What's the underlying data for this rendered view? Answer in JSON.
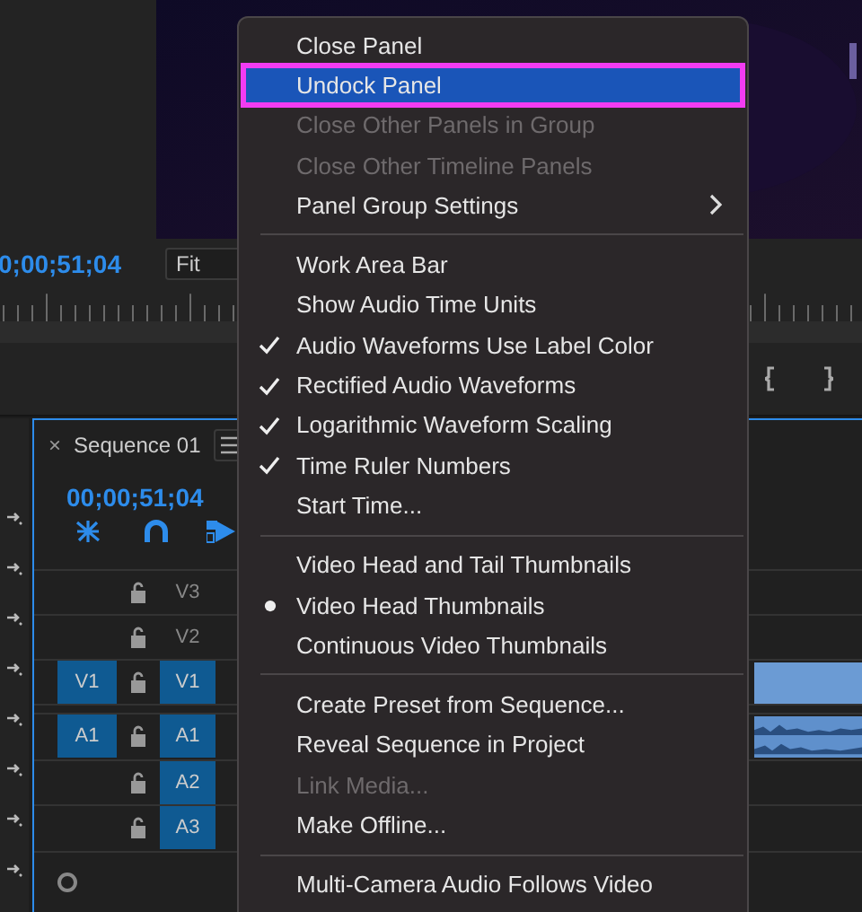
{
  "monitor": {
    "timecode": "0;00;51;04",
    "zoom": "Fit"
  },
  "sequence": {
    "close": "×",
    "tab": "Sequence 01",
    "timecode": "00;00;51;04",
    "tracks": [
      {
        "kind": "video",
        "label": "V3",
        "targeted": false,
        "clip": false
      },
      {
        "kind": "video",
        "label": "V2",
        "targeted": false,
        "clip": false
      },
      {
        "kind": "video",
        "source": "V1",
        "label": "V1",
        "targeted": true,
        "clip": true
      },
      {
        "kind": "audio",
        "source": "A1",
        "label": "A1",
        "targeted": true,
        "clip": true
      },
      {
        "kind": "audio",
        "label": "A2",
        "targeted": true,
        "clip": false
      },
      {
        "kind": "audio",
        "label": "A3",
        "targeted": true,
        "clip": false
      }
    ]
  },
  "menu": {
    "items": [
      {
        "kind": "item",
        "label": "Close Panel",
        "checked": false,
        "disabled": false,
        "selected": false,
        "submenu": false
      },
      {
        "kind": "item",
        "label": "Undock Panel",
        "checked": false,
        "disabled": false,
        "selected": true,
        "submenu": false
      },
      {
        "kind": "item",
        "label": "Close Other Panels in Group",
        "checked": false,
        "disabled": true,
        "selected": false,
        "submenu": false
      },
      {
        "kind": "item",
        "label": "Close Other Timeline Panels",
        "checked": false,
        "disabled": true,
        "selected": false,
        "submenu": false
      },
      {
        "kind": "item",
        "label": "Panel Group Settings",
        "checked": false,
        "disabled": false,
        "selected": false,
        "submenu": true
      },
      {
        "kind": "separator"
      },
      {
        "kind": "item",
        "label": "Work Area Bar",
        "checked": false,
        "disabled": false,
        "selected": false,
        "submenu": false
      },
      {
        "kind": "item",
        "label": "Show Audio Time Units",
        "checked": false,
        "disabled": false,
        "selected": false,
        "submenu": false
      },
      {
        "kind": "item",
        "label": "Audio Waveforms Use Label Color",
        "checked": true,
        "disabled": false,
        "selected": false,
        "submenu": false
      },
      {
        "kind": "item",
        "label": "Rectified Audio Waveforms",
        "checked": true,
        "disabled": false,
        "selected": false,
        "submenu": false
      },
      {
        "kind": "item",
        "label": "Logarithmic Waveform Scaling",
        "checked": true,
        "disabled": false,
        "selected": false,
        "submenu": false
      },
      {
        "kind": "item",
        "label": "Time Ruler Numbers",
        "checked": true,
        "disabled": false,
        "selected": false,
        "submenu": false
      },
      {
        "kind": "item",
        "label": "Start Time...",
        "checked": false,
        "disabled": false,
        "selected": false,
        "submenu": false
      },
      {
        "kind": "separator"
      },
      {
        "kind": "radio",
        "label": "Video Head and Tail Thumbnails",
        "checked": false,
        "disabled": false,
        "selected": false,
        "submenu": false
      },
      {
        "kind": "radio",
        "label": "Video Head Thumbnails",
        "checked": true,
        "disabled": false,
        "selected": false,
        "submenu": false
      },
      {
        "kind": "radio",
        "label": "Continuous Video Thumbnails",
        "checked": false,
        "disabled": false,
        "selected": false,
        "submenu": false
      },
      {
        "kind": "separator"
      },
      {
        "kind": "item",
        "label": "Create Preset from Sequence...",
        "checked": false,
        "disabled": false,
        "selected": false,
        "submenu": false
      },
      {
        "kind": "item",
        "label": "Reveal Sequence in Project",
        "checked": false,
        "disabled": false,
        "selected": false,
        "submenu": false
      },
      {
        "kind": "item",
        "label": "Link Media...",
        "checked": false,
        "disabled": true,
        "selected": false,
        "submenu": false
      },
      {
        "kind": "item",
        "label": "Make Offline...",
        "checked": false,
        "disabled": false,
        "selected": false,
        "submenu": false
      },
      {
        "kind": "separator"
      },
      {
        "kind": "item",
        "label": "Multi-Camera Audio Follows Video",
        "checked": false,
        "disabled": false,
        "selected": false,
        "submenu": false
      }
    ]
  }
}
